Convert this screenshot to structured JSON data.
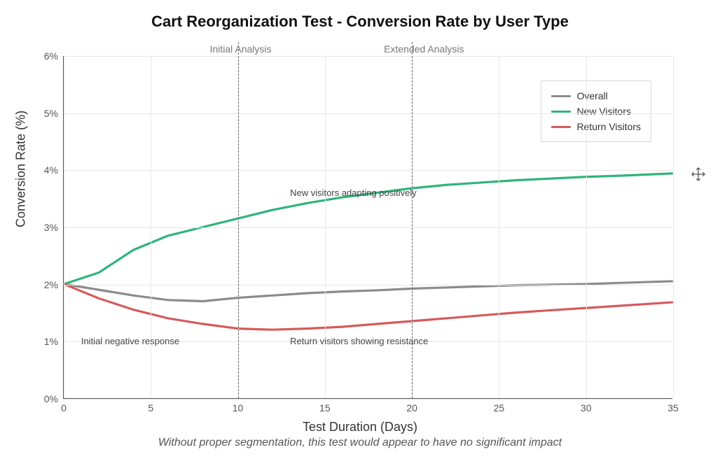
{
  "chart_data": {
    "type": "line",
    "title": "Cart Reorganization Test - Conversion Rate by User Type",
    "subtitle": "Without proper segmentation, this test would appear to have no significant impact",
    "xlabel": "Test Duration (Days)",
    "ylabel": "Conversion Rate (%)",
    "xlim": [
      0,
      35
    ],
    "ylim": [
      0,
      6
    ],
    "x_ticks": [
      0,
      5,
      10,
      15,
      20,
      25,
      30,
      35
    ],
    "y_ticks": [
      0,
      1,
      2,
      3,
      4,
      5,
      6
    ],
    "y_tick_suffix": "%",
    "ref_lines": [
      {
        "x": 10,
        "label": "Initial Analysis"
      },
      {
        "x": 20,
        "label": "Extended Analysis"
      }
    ],
    "annotations": [
      {
        "text": "New visitors adapting positively",
        "x": 13,
        "y": 3.7
      },
      {
        "text": "Return visitors showing resistance",
        "x": 13,
        "y": 1.1
      },
      {
        "text": "Initial negative response",
        "x": 1,
        "y": 1.1
      }
    ],
    "x": [
      0,
      2,
      4,
      6,
      8,
      10,
      12,
      14,
      16,
      18,
      20,
      22,
      24,
      26,
      28,
      30,
      32,
      35
    ],
    "series": [
      {
        "name": "Overall",
        "color": "#8b8b8b",
        "values": [
          2.0,
          1.9,
          1.8,
          1.72,
          1.7,
          1.76,
          1.8,
          1.84,
          1.87,
          1.89,
          1.92,
          1.94,
          1.96,
          1.98,
          1.99,
          2.0,
          2.02,
          2.05
        ]
      },
      {
        "name": "New Visitors",
        "color": "#2fb47a",
        "values": [
          2.0,
          2.2,
          2.6,
          2.85,
          3.0,
          3.15,
          3.3,
          3.42,
          3.52,
          3.6,
          3.68,
          3.74,
          3.78,
          3.82,
          3.85,
          3.88,
          3.9,
          3.94
        ]
      },
      {
        "name": "Return Visitors",
        "color": "#d65a5a",
        "values": [
          2.0,
          1.75,
          1.55,
          1.4,
          1.3,
          1.22,
          1.2,
          1.22,
          1.25,
          1.3,
          1.35,
          1.4,
          1.45,
          1.5,
          1.54,
          1.58,
          1.62,
          1.68
        ]
      }
    ]
  },
  "icons": {
    "move_cursor": "move-icon"
  }
}
